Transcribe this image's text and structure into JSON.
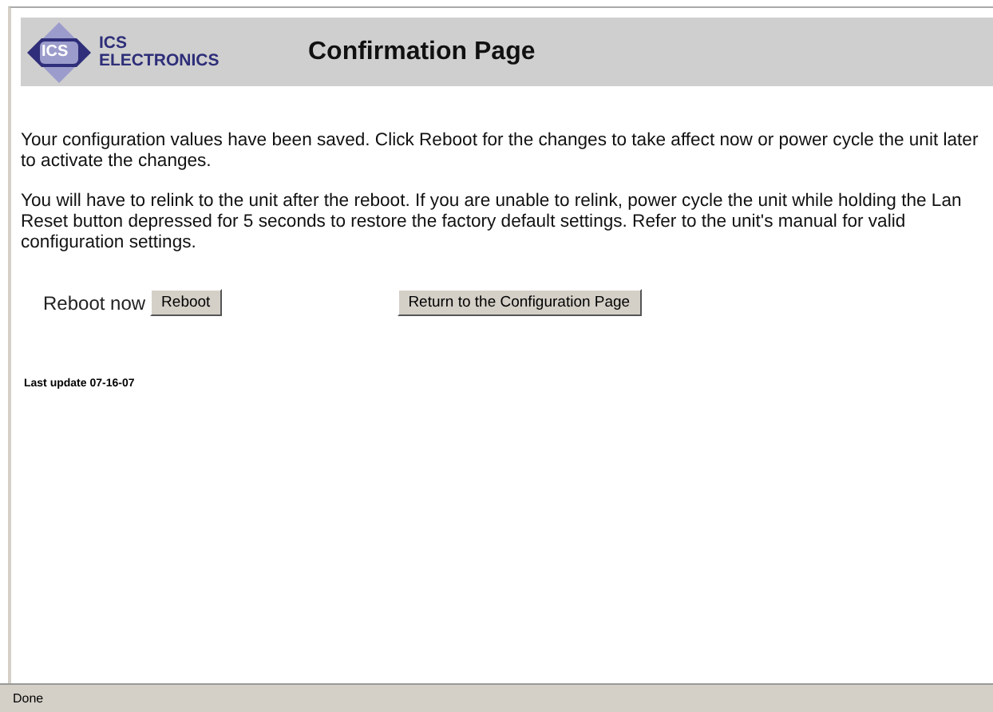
{
  "header": {
    "logo_badge": "ICS",
    "logo_line_1": "ICS",
    "logo_line_2": "ELECTRONICS",
    "title": "Confirmation Page"
  },
  "paragraphs": [
    "Your configuration values have been saved. Click Reboot for the changes to take affect now or power cycle the unit later to activate the changes.",
    "You will have to relink to the unit after the reboot. If you are unable to relink, power cycle the unit while holding the Lan Reset button depressed for 5 seconds to restore the factory default settings. Refer to the unit's manual for valid configuration settings."
  ],
  "reboot": {
    "label": "Reboot now",
    "button": "Reboot"
  },
  "return_button": "Return to the Configuration Page",
  "last_update": "Last update 07-16-07",
  "status_bar": "Done"
}
